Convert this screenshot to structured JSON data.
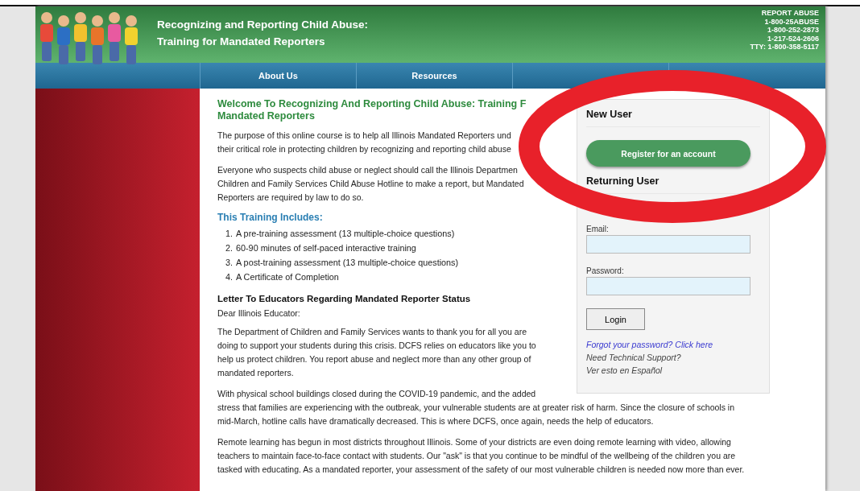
{
  "header": {
    "title_lines": [
      "Recognizing and Reporting Child Abuse:",
      "Training for Mandated Reporters"
    ],
    "hotline": [
      "REPORT ABUSE",
      "1-800-25ABUSE",
      "1-800-252-2873",
      "1-217-524-2606",
      "TTY: 1-800-358-5117"
    ]
  },
  "nav": [
    {
      "label": "About Us"
    },
    {
      "label": "Resources"
    }
  ],
  "welcome": {
    "title_lines": [
      "Welcome To Recognizing And Reporting Child Abuse: Training F",
      "Mandated Reporters"
    ],
    "paragraphs": [
      [
        "The purpose of this online course is to help all Illinois Mandated Reporters und",
        "their critical role in protecting children by recognizing and reporting child abuse"
      ],
      [
        "Everyone who suspects child abuse or neglect should call the Illinois Departmen",
        "Children and Family Services Child Abuse Hotline to make a report, but Mandated",
        "Reporters are required by law to do so."
      ]
    ]
  },
  "training": {
    "heading": "This Training Includes:",
    "items": [
      {
        "number": "1.",
        "text": "A pre-training assessment (13 multiple-choice questions)"
      },
      {
        "number": "2.",
        "text": "60-90 minutes of self-paced interactive training"
      },
      {
        "number": "3.",
        "text": "A post-training assessment (13 multiple-choice questions)"
      },
      {
        "number": "4.",
        "text": "A Certificate of Completion"
      }
    ]
  },
  "letter": {
    "heading": "Letter To Educators Regarding Mandated Reporter Status",
    "greeting": "Dear Illinois Educator:",
    "paragraphs": [
      [
        "The Department of Children and Family Services wants to thank you for all you are",
        "doing to support your students during this crisis. DCFS relies on educators like you to",
        "help us protect children. You report abuse and neglect more than any other group of",
        "mandated reporters."
      ],
      [
        "With physical school buildings closed during the COVID-19 pandemic, and the added",
        "stress that families are experiencing with the outbreak, your vulnerable students are at greater risk of harm. Since the closure of schools in",
        "mid-March, hotline calls have dramatically decreased. This is where DCFS, once again, needs the help of educators."
      ],
      [
        "Remote learning has begun in most districts throughout Illinois. Some of your districts are even doing remote learning with video, allowing",
        "teachers to maintain face-to-face contact with students. Our \"ask\" is that you continue to be mindful of the wellbeing of the children you are",
        "tasked with educating. As a mandated reporter, your assessment of the safety of our most vulnerable children is needed now more than ever."
      ]
    ]
  },
  "login_panel": {
    "new_user_heading": "New User",
    "register_button": "Register for an account",
    "returning_user_heading": "Returning User",
    "fields": [
      {
        "label": "Email:"
      },
      {
        "label": "Password:"
      }
    ],
    "login_button": "Login",
    "forgot_link": "Forgot your password? Click here",
    "support_text": "Need Technical Support?",
    "spanish_text": "Ver esto en Español"
  }
}
